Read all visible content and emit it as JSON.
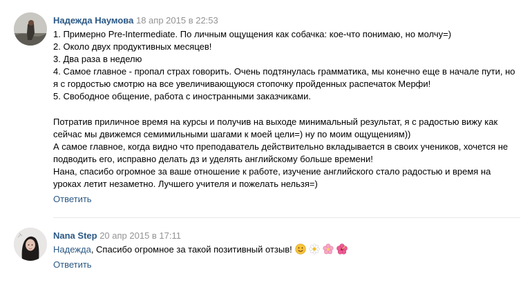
{
  "comments": [
    {
      "author": "Надежда Наумова",
      "date": "18 апр 2015 в 22:53",
      "avatar": "avatar-photo",
      "lines": [
        "1. Примерно Pre-Intermediate. По личным ощущения как собачка: кое-что понимаю, но молчу=)",
        "2. Около двух продуктивных месяцев!",
        "3. Два раза в неделю",
        "4. Самое главное - пропал страх говорить. Очень подтянулась грамматика, мы конечно еще в начале пути, но я с гордостью смотрю на все увеличивающуюся стопочку пройденных распечаток Мерфи!",
        "5. Свободное общение, работа с иностранными заказчиками.",
        "",
        "Потратив приличное время на курсы и получив на выходе минимальный результат, я с радостью вижу как сейчас мы движемся семимильными шагами к моей цели=) ну по моим ощущениям))",
        "А самое главное, когда видно что преподаватель действительно вкладывается в своих учеников, хочется не подводить его, исправно делать дз и уделять английскому больше времени!",
        "Нана, спасибо огромное за ваше отношение к работе, изучение английского стало радостью и время на уроках летит незаметно. Лучшего учителя и пожелать нельзя=)"
      ],
      "reply_label": "Ответить"
    },
    {
      "author": "Nana Step",
      "date": "20 апр 2015 в 17:11",
      "avatar": "avatar-photo",
      "mention": "Надежда",
      "text_after_mention": ", Спасибо огромное за такой позитивный отзыв!",
      "emojis": [
        "smiling-face-emoji",
        "daisy-emoji",
        "cherry-blossom-emoji",
        "hibiscus-emoji"
      ],
      "reply_label": "Ответить"
    }
  ],
  "colors": {
    "link": "#2a5885",
    "date": "#939393",
    "separator": "#e7e8ec"
  }
}
